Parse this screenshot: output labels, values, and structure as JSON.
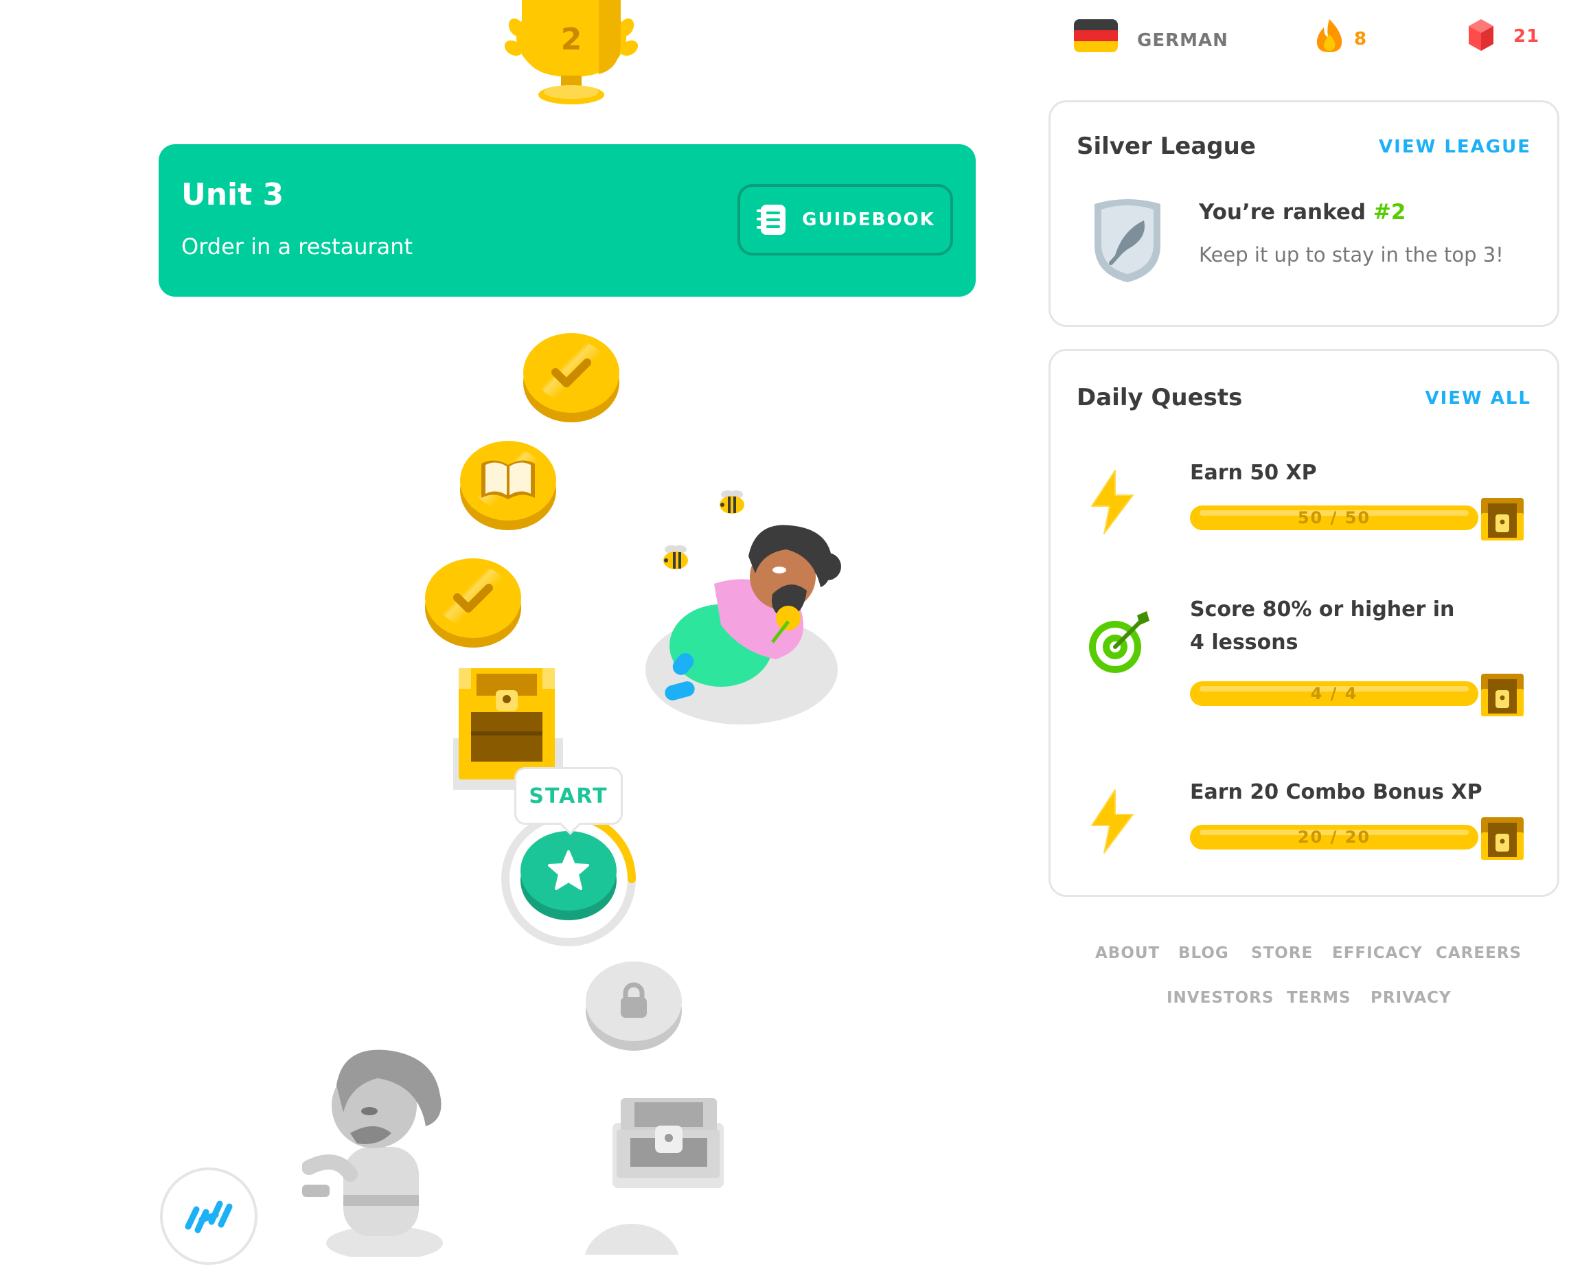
{
  "unit": {
    "title": "Unit 3",
    "subtitle": "Order in a restaurant",
    "guidebook_label": "GUIDEBOOK"
  },
  "trophy": {
    "number": "2"
  },
  "path": {
    "start_label": "START",
    "nodes": [
      "completed-check",
      "completed-book",
      "completed-check",
      "treasure-chest",
      "current-star",
      "locked",
      "locked-chest"
    ],
    "start_progress": 0.25
  },
  "header": {
    "language": "GERMAN",
    "streak": "8",
    "gems": "21"
  },
  "league": {
    "title": "Silver League",
    "link": "VIEW LEAGUE",
    "rank_prefix": "You’re ranked ",
    "rank": "#2",
    "subtitle": "Keep it up to stay in the top 3!"
  },
  "quests": {
    "title": "Daily Quests",
    "link": "VIEW ALL",
    "items": [
      {
        "title": "Earn 50 XP",
        "progress_text": "50 / 50",
        "progress": 1.0,
        "icon": "lightning-icon"
      },
      {
        "title": "Score 80% or higher in 4 lessons",
        "progress_text": "4 / 4",
        "progress": 1.0,
        "icon": "target-icon"
      },
      {
        "title": "Earn 20 Combo Bonus XP",
        "progress_text": "20 / 20",
        "progress": 1.0,
        "icon": "lightning-icon"
      }
    ]
  },
  "footer": {
    "links": [
      "ABOUT",
      "BLOG",
      "STORE",
      "EFFICACY",
      "CAREERS",
      "INVESTORS",
      "TERMS",
      "PRIVACY"
    ]
  },
  "colors": {
    "unit_green": "#00cd9c",
    "coin_gold": "#ffc800",
    "link_blue": "#1cb0f6",
    "streak_orange": "#ff9600",
    "gem_red": "#ff4b4b",
    "rank_green": "#58cc02"
  }
}
